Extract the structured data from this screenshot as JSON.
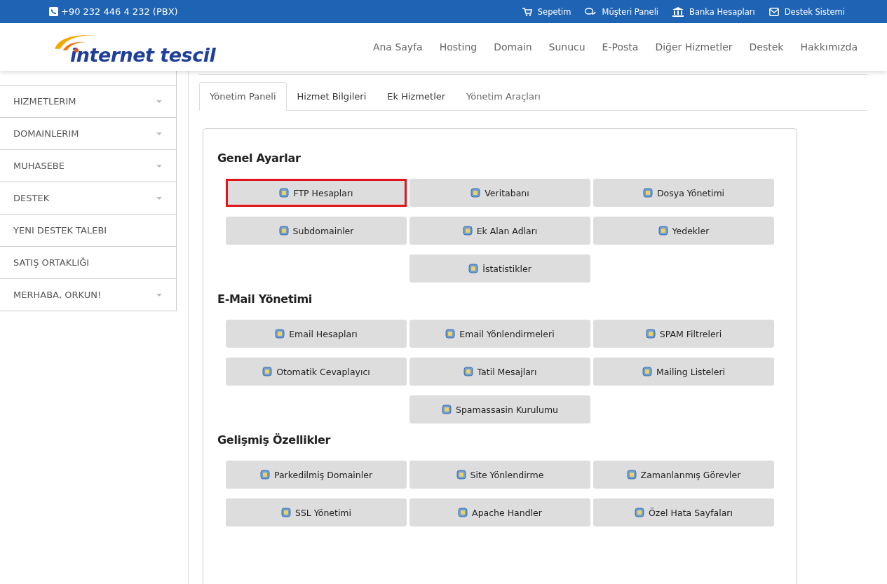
{
  "topbar": {
    "phone": "+90 232 446 4 232 (PBX)",
    "links": [
      {
        "label": "Sepetim",
        "kind": "cart"
      },
      {
        "label": "Müşteri Paneli",
        "kind": "chat"
      },
      {
        "label": "Banka Hesapları",
        "kind": "bank"
      },
      {
        "label": "Destek Sistemi",
        "kind": "mail"
      }
    ]
  },
  "logo": {
    "text": "internet tescil"
  },
  "nav": [
    "Ana Sayfa",
    "Hosting",
    "Domain",
    "Sunucu",
    "E-Posta",
    "Diğer Hizmetler",
    "Destek",
    "Hakkımızda"
  ],
  "sidebar": {
    "items": [
      {
        "label": "HIZMETLERIM",
        "dropdown": true
      },
      {
        "label": "DOMAINLERIM",
        "dropdown": true
      },
      {
        "label": "MUHASEBE",
        "dropdown": true
      },
      {
        "label": "DESTEK",
        "dropdown": true
      },
      {
        "label": "YENI DESTEK TALEBI",
        "dropdown": false
      },
      {
        "label": "SATIŞ ORTAKLIĞI",
        "dropdown": false
      },
      {
        "label": "MERHABA, ORKUN!",
        "dropdown": true
      }
    ]
  },
  "tabs": [
    {
      "label": "Yönetim Paneli",
      "selected": true
    },
    {
      "label": "Hizmet Bilgileri",
      "selected": false
    },
    {
      "label": "Ek Hizmetler",
      "selected": false
    },
    {
      "label": "Yönetim Araçları",
      "selected": false
    }
  ],
  "sections": [
    {
      "title": "Genel Ayarlar",
      "buttons": [
        {
          "label": "FTP Hesapları",
          "highlighted": true
        },
        {
          "label": "Veritabanı",
          "highlighted": false
        },
        {
          "label": "Dosya Yönetimi",
          "highlighted": false
        },
        {
          "label": "Subdomainler",
          "highlighted": false
        },
        {
          "label": "Ek Alan Adları",
          "highlighted": false
        },
        {
          "label": "Yedekler",
          "highlighted": false
        },
        {
          "label": "İstatistikler",
          "highlighted": false
        }
      ]
    },
    {
      "title": "E-Mail Yönetimi",
      "buttons": [
        {
          "label": "Email Hesapları",
          "highlighted": false
        },
        {
          "label": "Email Yönlendirmeleri",
          "highlighted": false
        },
        {
          "label": "SPAM Filtreleri",
          "highlighted": false
        },
        {
          "label": "Otomatik Cevaplayıcı",
          "highlighted": false
        },
        {
          "label": "Tatil Mesajları",
          "highlighted": false
        },
        {
          "label": "Mailing Listeleri",
          "highlighted": false
        },
        {
          "label": "Spamassasin Kurulumu",
          "highlighted": false
        }
      ]
    },
    {
      "title": "Gelişmiş Özellikler",
      "buttons": [
        {
          "label": "Parkedilmiş Domainler",
          "highlighted": false
        },
        {
          "label": "Site Yönlendirme",
          "highlighted": false
        },
        {
          "label": "Zamanlanmış Görevler",
          "highlighted": false
        },
        {
          "label": "SSL Yönetimi",
          "highlighted": false
        },
        {
          "label": "Apache Handler",
          "highlighted": false
        },
        {
          "label": "Özel Hata Sayfaları",
          "highlighted": false
        }
      ]
    }
  ]
}
